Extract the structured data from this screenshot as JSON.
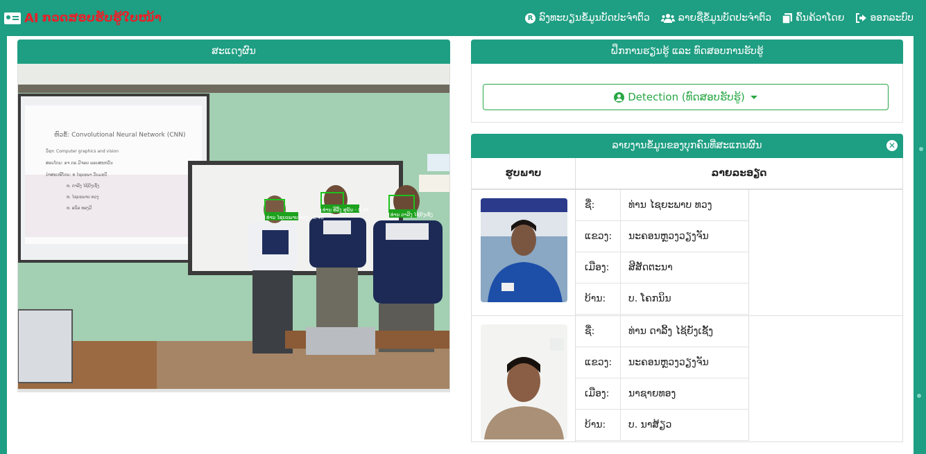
{
  "header": {
    "brand_ai": "AI",
    "brand_title": "ກວດສອບຮັບຮູ້ໃບໜ້າ",
    "nav": [
      {
        "label": "ລົງທະບຽນຂໍ້ມູນບັດປະຈຳຕົວ",
        "icon": "registered-icon"
      },
      {
        "label": "ລາຍຊື່ຂໍ້ມູນບັດປະຈຳຕົວ",
        "icon": "users-icon"
      },
      {
        "label": "ຄົ້ນຄ້ວາໂດຍ",
        "icon": "copy-icon"
      },
      {
        "label": "ອອກລະບົບ",
        "icon": "sign-out-icon"
      }
    ]
  },
  "left": {
    "title": "ສະແດງຜົນ",
    "slide": {
      "title": "ຫົວຂໍ້: Convolutional Neural Network (CNN)",
      "lines": [
        "ວິຊາ: Computer graphics and vision",
        "ສອນໂດຍ: ອຈ ດຣ ມີຈອຍ ພອນສະຫວັນ",
        "ນຳສະເໜີໂດຍ: ທ ໄຊຍະພາ ວັນມະນີ",
        "ທ. ດາລີງ ໄຊ້ຍັງເຊັ້ງ",
        "ທ. ໄຊຍະພາບ ທວງ",
        "ທ. ອນິລ ທອງມີ"
      ]
    },
    "detections": [
      {
        "label": "ທ່ານ ໄຊຍະພາບ ທວງ - 0.48"
      },
      {
        "label": "ທ່ານ ອີລີ້ງ ສຸພັນ - 0.46"
      },
      {
        "label": "ທ່ານ ດາລີງ ໄຊ້ຍັງເຊັ້ງ"
      }
    ]
  },
  "right": {
    "training_title": "ຝຶກການຮຽນຮູ້ ແລະ ທົດສອບການຮັບຮູ້",
    "detect_button": "Detection (ທົດສອບຮັບຮູ້)",
    "report_title": "ລາຍງານຂໍ້ມູນຂອງບຸກຄົນທີ່ສະແກນຜົນ",
    "columns": {
      "photo": "ຮູບພາບ",
      "detail": "ລາຍລະອຽດ"
    },
    "people": [
      {
        "rows": [
          {
            "k": "ຊື່:",
            "v": "ທ່ານ ໄຊຍະພາບ ທວງ"
          },
          {
            "k": "ແຂວງ:",
            "v": "ນະຄອນຫຼວງວຽງຈັນ"
          },
          {
            "k": "ເມືອງ:",
            "v": "ສີສັດຕະນາ"
          },
          {
            "k": "ບ້ານ:",
            "v": "ບ. ໂຄກນິນ"
          }
        ]
      },
      {
        "rows": [
          {
            "k": "ຊື່:",
            "v": "ທ່ານ ດາລີ້ງ ໄຊ້ຍັງເຊັ້ງ"
          },
          {
            "k": "ແຂວງ:",
            "v": "ນະຄອນຫຼວງວຽງຈັນ"
          },
          {
            "k": "ເມືອງ:",
            "v": "ນາຊາຍທອງ"
          },
          {
            "k": "ບ້ານ:",
            "v": "ບ. ນາສ້ຽວ"
          }
        ]
      }
    ]
  }
}
